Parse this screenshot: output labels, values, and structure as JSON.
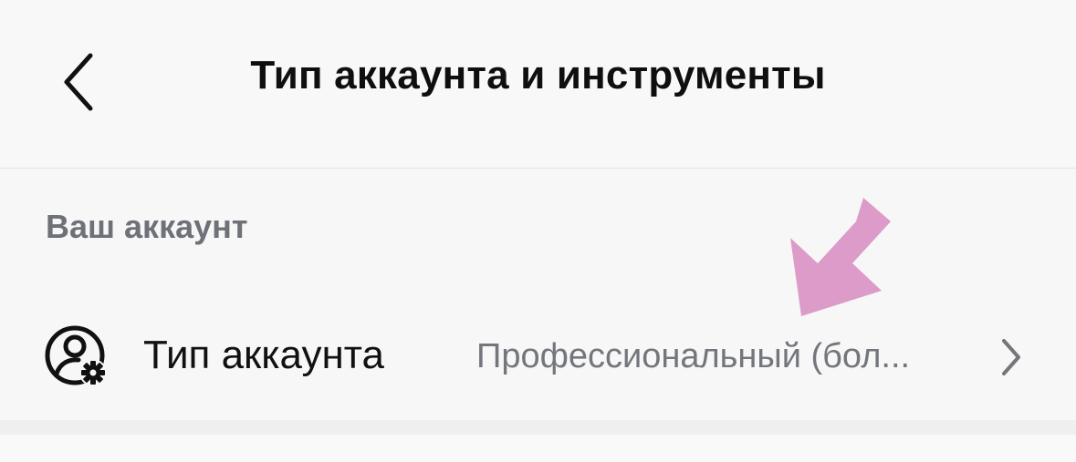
{
  "header": {
    "title": "Тип аккаунта и инструменты",
    "back_icon": "chevron-left-icon"
  },
  "section": {
    "label": "Ваш аккаунт"
  },
  "account_type_row": {
    "icon": "user-gear-icon",
    "label": "Тип аккаунта",
    "value": "Профессиональный (бол...",
    "chevron_icon": "chevron-right-icon"
  },
  "annotation": {
    "arrow_icon": "pointer-arrow-icon",
    "color": "#dc9bc8"
  },
  "colors": {
    "background": "#f7f7f7",
    "title": "#0f0f0f",
    "section_label": "#6f7178",
    "value_text": "#74767d"
  }
}
